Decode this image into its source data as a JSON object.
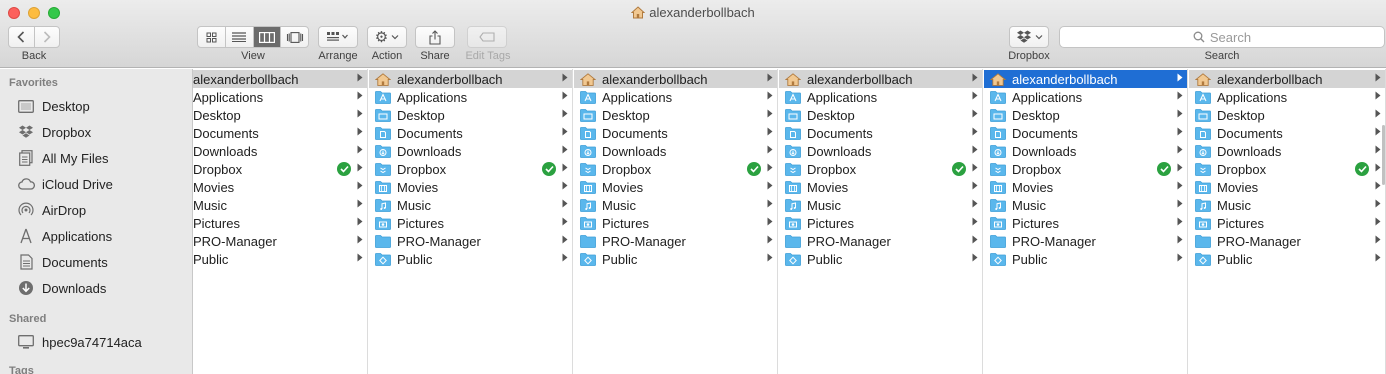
{
  "window": {
    "title": "alexanderbollbach"
  },
  "toolbar": {
    "back_label": "Back",
    "view_label": "View",
    "arrange_label": "Arrange",
    "action_label": "Action",
    "share_label": "Share",
    "edit_tags_label": "Edit Tags",
    "dropbox_label": "Dropbox",
    "search_label": "Search",
    "search_placeholder": "Search"
  },
  "sidebar": {
    "favorites_heading": "Favorites",
    "favorites": [
      {
        "label": "Desktop",
        "icon": "desktop-icon"
      },
      {
        "label": "Dropbox",
        "icon": "dropbox-icon"
      },
      {
        "label": "All My Files",
        "icon": "all-files-icon"
      },
      {
        "label": "iCloud Drive",
        "icon": "cloud-icon"
      },
      {
        "label": "AirDrop",
        "icon": "airdrop-icon"
      },
      {
        "label": "Applications",
        "icon": "applications-icon"
      },
      {
        "label": "Documents",
        "icon": "documents-icon"
      },
      {
        "label": "Downloads",
        "icon": "downloads-icon"
      }
    ],
    "shared_heading": "Shared",
    "shared": [
      {
        "label": "hpec9a74714aca",
        "icon": "computer-icon"
      }
    ],
    "tags_heading": "Tags"
  },
  "column": {
    "header": "alexanderbollbach",
    "items": [
      "Applications",
      "Desktop",
      "Documents",
      "Downloads",
      "Dropbox",
      "Movies",
      "Music",
      "Pictures",
      "PRO-Manager",
      "Public"
    ]
  },
  "colors": {
    "accent": "#1f6ed4",
    "folder": "#5ab7ec",
    "sync": "#2ba140"
  }
}
